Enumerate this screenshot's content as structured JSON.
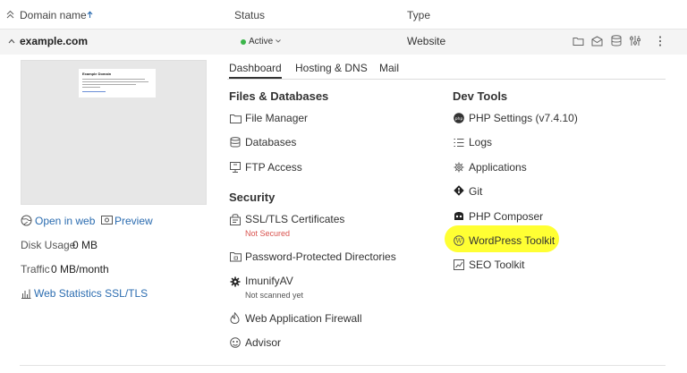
{
  "header": {
    "domain_col": "Domain name",
    "status_col": "Status",
    "type_col": "Type"
  },
  "row": {
    "domain": "example.com",
    "status": "Active",
    "type": "Website"
  },
  "preview": {
    "thumb_title": "Example Domain",
    "open_in_web": "Open in web",
    "preview": "Preview",
    "disk_usage_label": "Disk Usage",
    "disk_usage_value": "0 MB",
    "traffic_label": "Traffic",
    "traffic_value": "0 MB/month",
    "web_stats": "Web Statistics SSL/TLS"
  },
  "tabs": {
    "dashboard": "Dashboard",
    "hosting": "Hosting & DNS",
    "mail": "Mail"
  },
  "files": {
    "title": "Files & Databases",
    "file_manager": "File Manager",
    "databases": "Databases",
    "ftp": "FTP Access"
  },
  "security": {
    "title": "Security",
    "ssl": "SSL/TLS Certificates",
    "ssl_status": "Not Secured",
    "ppd": "Password-Protected Directories",
    "imunify": "ImunifyAV",
    "imunify_status": "Not scanned yet",
    "waf": "Web Application Firewall",
    "advisor": "Advisor"
  },
  "devtools": {
    "title": "Dev Tools",
    "php": "PHP Settings (v7.4.10)",
    "logs": "Logs",
    "applications": "Applications",
    "git": "Git",
    "composer": "PHP Composer",
    "wordpress": "WordPress Toolkit",
    "seo": "SEO Toolkit"
  },
  "colors": {
    "active_dot": "#3bb54a",
    "link": "#2b6cb0",
    "highlight": "#ffff33",
    "warn": "#d9534f"
  }
}
